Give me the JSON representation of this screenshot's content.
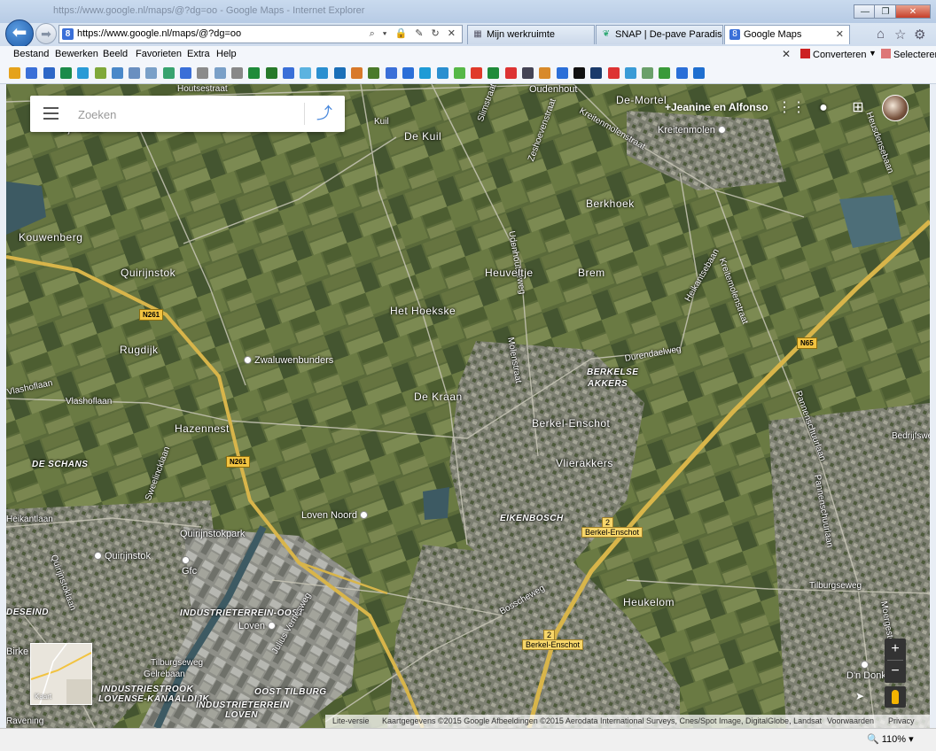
{
  "browser": {
    "window_title": "https://www.google.nl/maps/@?dg=oo - Google Maps - Internet Explorer",
    "url_scheme": "https://",
    "url_host": "www.google.nl",
    "url_path": "/maps/@?dg=oo",
    "address_icons": "⌕ ▾ 🔒 ✎ ↻ ✕",
    "tabs": [
      {
        "label": "Mijn werkruimte",
        "icon": "grid-icon"
      },
      {
        "label": "SNAP | De-pave Paradise i...",
        "icon": "leaf-icon"
      },
      {
        "label": "Google Maps",
        "icon": "google-icon",
        "active": true
      }
    ],
    "close_tab": "✕",
    "menu": [
      "Bestand",
      "Bewerken",
      "Beeld",
      "Favorieten",
      "Extra",
      "Help"
    ],
    "toolbar_close": "✕",
    "convert_label": "Converteren",
    "select_label": "Selecteren",
    "zoom_level": "🔍 110%  ▾",
    "window_buttons": {
      "minimize": "—",
      "maximize": "❐",
      "close": "✕"
    }
  },
  "map": {
    "search_placeholder": "Zoeken",
    "user_name": "+Jeanine en Alfonso",
    "places": [
      {
        "name": "Houtsestraat",
        "cls": "road"
      },
      {
        "name": "Oudenhout",
        "cls": ""
      },
      {
        "name": "De-Mortel",
        "cls": "big"
      },
      {
        "name": "Kuil",
        "cls": "road"
      },
      {
        "name": "De Kuil",
        "cls": "big"
      },
      {
        "name": "Slimstraat",
        "cls": "road"
      },
      {
        "name": "Zeshoevenstraat",
        "cls": "road"
      },
      {
        "name": "Kreitenmolenstraat",
        "cls": "road"
      },
      {
        "name": "Heusdensebaan",
        "cls": "road"
      },
      {
        "name": "Vijfhuizen",
        "cls": ""
      },
      {
        "name": "Udenhoutseweg",
        "cls": "road"
      },
      {
        "name": "Berkhoek",
        "cls": "big"
      },
      {
        "name": "Kouwenberg",
        "cls": "big"
      },
      {
        "name": "Quirijnstok",
        "cls": "big"
      },
      {
        "name": "Heuveltje",
        "cls": "big"
      },
      {
        "name": "Brem",
        "cls": "big"
      },
      {
        "name": "Kreitemolenstraat",
        "cls": "road"
      },
      {
        "name": "Het Hoekske",
        "cls": "big"
      },
      {
        "name": "Heikantsebaan",
        "cls": "road"
      },
      {
        "name": "Molenstraat",
        "cls": "road"
      },
      {
        "name": "Rugdijk",
        "cls": "big"
      },
      {
        "name": "Durendaelweg",
        "cls": "road"
      },
      {
        "name": "BERKELSE",
        "cls": "district"
      },
      {
        "name": "AKKERS",
        "cls": "district"
      },
      {
        "name": "Pannenschuurlaan",
        "cls": "road"
      },
      {
        "name": "Vlashoflaan",
        "cls": "road"
      },
      {
        "name": "Vlashoflaan",
        "cls": "road"
      },
      {
        "name": "Hazennest",
        "cls": "big"
      },
      {
        "name": "De Kraan",
        "cls": "big"
      },
      {
        "name": "Berkel-Enschot",
        "cls": "big"
      },
      {
        "name": "Bedrijfsweg",
        "cls": "road"
      },
      {
        "name": "Vlierakkers",
        "cls": "big"
      },
      {
        "name": "DE SCHANS",
        "cls": "district"
      },
      {
        "name": "Sweelincklaan",
        "cls": "road"
      },
      {
        "name": "Pannenschuurlaan",
        "cls": "road"
      },
      {
        "name": "Heikantlaan",
        "cls": "road"
      },
      {
        "name": "EIKENBOSCH",
        "cls": "district"
      },
      {
        "name": "Quirijnstokpark",
        "cls": ""
      },
      {
        "name": "Quirijnstoklaan",
        "cls": "road"
      },
      {
        "name": "Tilburgseweg",
        "cls": "road"
      },
      {
        "name": "Moergestelse",
        "cls": "road"
      },
      {
        "name": "Heukelom",
        "cls": "big"
      },
      {
        "name": "Bosscheweg",
        "cls": "road"
      },
      {
        "name": "DESEIND",
        "cls": "district"
      },
      {
        "name": "INDUSTRIETERREIN-OOST",
        "cls": "district"
      },
      {
        "name": "Julius Vernesweg",
        "cls": "road"
      },
      {
        "name": "Gelrebaan",
        "cls": "road"
      },
      {
        "name": "INDUSTRIESTROOK",
        "cls": "district"
      },
      {
        "name": "LOVENSE-KANAALDIJK",
        "cls": "district"
      },
      {
        "name": "OOST TILBURG",
        "cls": "district"
      },
      {
        "name": "INDUSTRIETERREIN",
        "cls": "district"
      },
      {
        "name": "LOVEN",
        "cls": "district"
      },
      {
        "name": "Kaart",
        "cls": ""
      },
      {
        "name": "Birke",
        "cls": ""
      },
      {
        "name": "Tilburgseweg",
        "cls": "road"
      },
      {
        "name": "Ravening",
        "cls": "road"
      }
    ],
    "pois": [
      {
        "name": "Kreitenmolen",
        "icon": "building-icon"
      },
      {
        "name": "Zwaluwenbunders",
        "icon": "building-icon"
      },
      {
        "name": "Loven Noord",
        "icon": "building-icon"
      },
      {
        "name": "Quirijnstok",
        "icon": "building-icon"
      },
      {
        "name": "Gfc",
        "icon": "building-icon"
      },
      {
        "name": "Loven",
        "icon": "building-icon"
      },
      {
        "name": "D'n Donk",
        "icon": "tree-icon"
      }
    ],
    "shields": [
      {
        "label": "N261"
      },
      {
        "label": "N261"
      },
      {
        "label": "N65"
      }
    ],
    "exits": [
      {
        "number": "2",
        "label": "Berkel-Enschot"
      },
      {
        "number": "2",
        "label": "Berkel-Enschot"
      }
    ],
    "minimap_label": "Kaart",
    "zoom_in": "+",
    "zoom_out": "−",
    "compass": "➤",
    "attribution": {
      "lite": "Lite-versie",
      "data": "Kaartgegevens ©2015 Google Afbeeldingen ©2015 Aerodata International Surveys, Cnes/Spot Image, DigitalGlobe, Landsat",
      "terms": "Voorwaarden",
      "privacy": "Privacy"
    },
    "colors": {
      "field_dark": "#4b5e34",
      "field_mid": "#6b7b45",
      "field_light": "#8a9359",
      "urban": "#8a8d83",
      "highway": "#d8b54a",
      "road": "#c9c7b8",
      "water": "#3d5a63"
    }
  }
}
